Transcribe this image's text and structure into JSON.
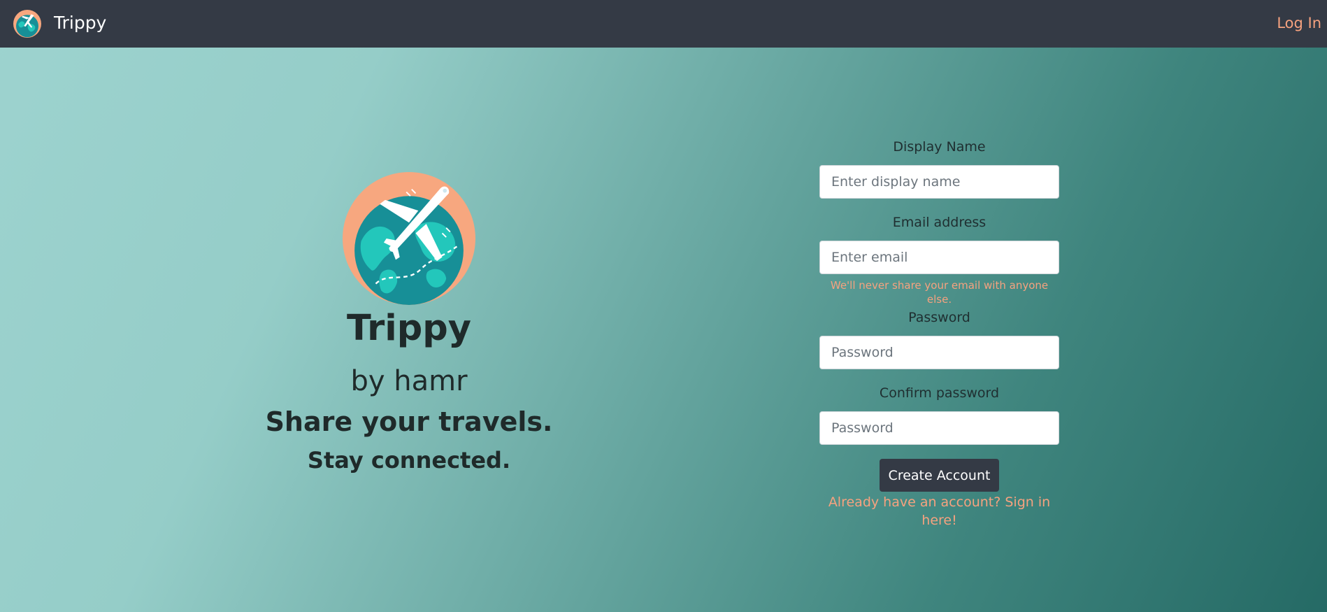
{
  "navbar": {
    "brand_name": "Trippy",
    "login_label": "Log In",
    "logo_icon": "globe-airplane-icon"
  },
  "hero": {
    "logo_icon": "globe-airplane-icon",
    "title": "Trippy",
    "byline": "by hamr",
    "tagline_1": "Share your travels.",
    "tagline_2": "Stay connected."
  },
  "form": {
    "display_name": {
      "label": "Display Name",
      "placeholder": "Enter display name",
      "value": ""
    },
    "email": {
      "label": "Email address",
      "placeholder": "Enter email",
      "value": "",
      "help": "We'll never share your email with anyone else."
    },
    "password": {
      "label": "Password",
      "placeholder": "Password",
      "value": ""
    },
    "confirm_password": {
      "label": "Confirm password",
      "placeholder": "Password",
      "value": ""
    },
    "submit_label": "Create Account",
    "signin_link": "Already have an account? Sign in here!"
  },
  "colors": {
    "navbar": "#343a45",
    "accent": "#f6a27f",
    "gradient_start": "#9dd3cf",
    "gradient_end": "#256a65",
    "globe_ocean": "#178f97",
    "globe_land": "#23c7bb"
  }
}
